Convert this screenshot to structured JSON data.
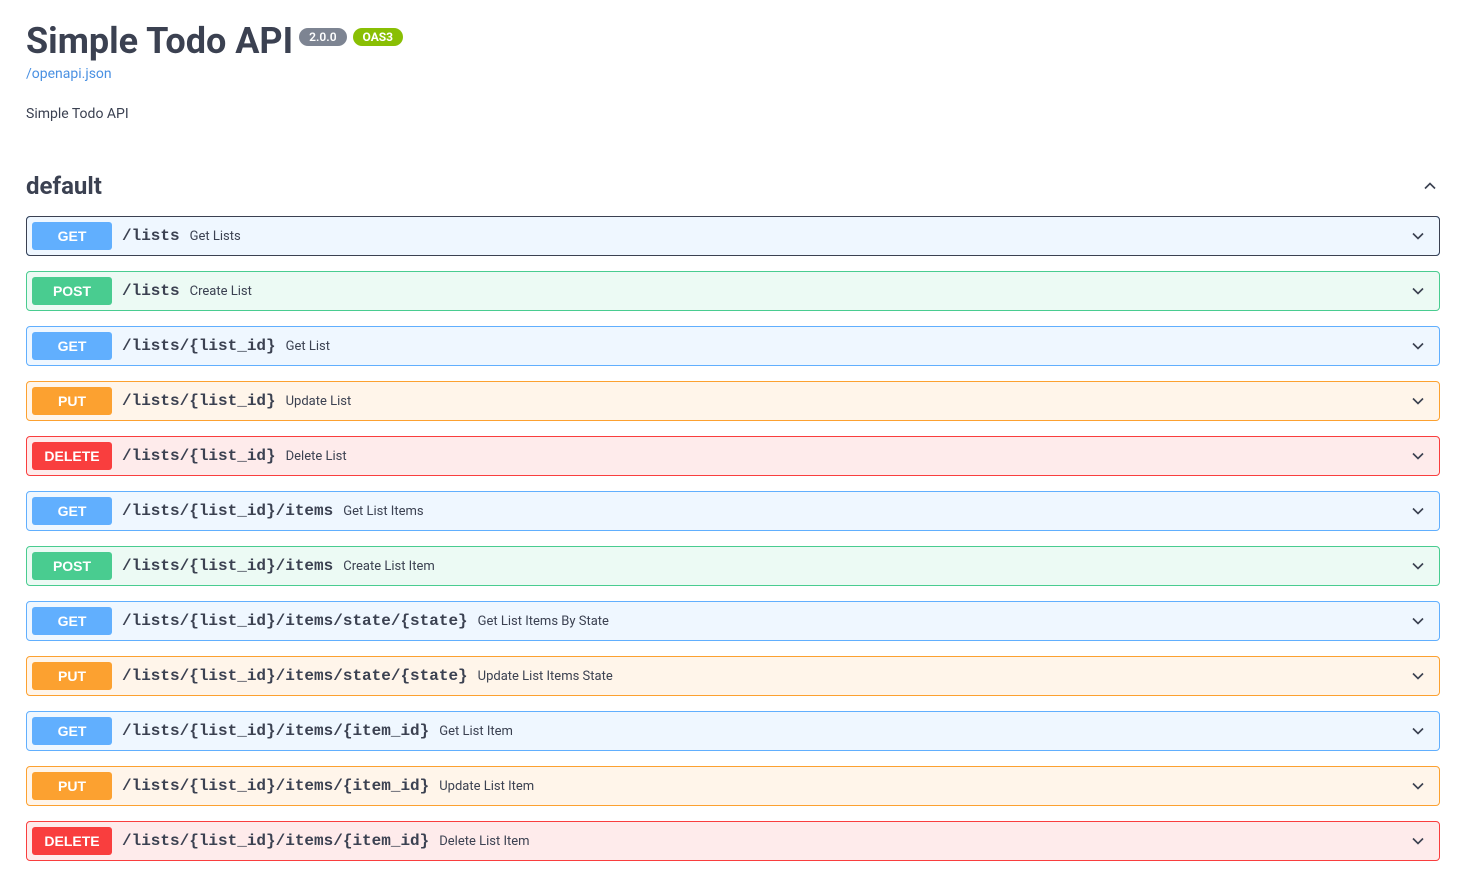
{
  "header": {
    "title": "Simple Todo API",
    "version": "2.0.0",
    "oas_label": "OAS3",
    "spec_link": "/openapi.json",
    "description": "Simple Todo API"
  },
  "section": {
    "title": "default",
    "expanded": true
  },
  "methods": {
    "get": "GET",
    "post": "POST",
    "put": "PUT",
    "delete": "DELETE"
  },
  "operations": [
    {
      "method": "get",
      "path": "/lists",
      "summary": "Get Lists",
      "focused": true
    },
    {
      "method": "post",
      "path": "/lists",
      "summary": "Create List",
      "focused": false
    },
    {
      "method": "get",
      "path": "/lists/{list_id}",
      "summary": "Get List",
      "focused": false
    },
    {
      "method": "put",
      "path": "/lists/{list_id}",
      "summary": "Update List",
      "focused": false
    },
    {
      "method": "delete",
      "path": "/lists/{list_id}",
      "summary": "Delete List",
      "focused": false
    },
    {
      "method": "get",
      "path": "/lists/{list_id}/items",
      "summary": "Get List Items",
      "focused": false
    },
    {
      "method": "post",
      "path": "/lists/{list_id}/items",
      "summary": "Create List Item",
      "focused": false
    },
    {
      "method": "get",
      "path": "/lists/{list_id}/items/state/{state}",
      "summary": "Get List Items By State",
      "focused": false
    },
    {
      "method": "put",
      "path": "/lists/{list_id}/items/state/{state}",
      "summary": "Update List Items State",
      "focused": false
    },
    {
      "method": "get",
      "path": "/lists/{list_id}/items/{item_id}",
      "summary": "Get List Item",
      "focused": false
    },
    {
      "method": "put",
      "path": "/lists/{list_id}/items/{item_id}",
      "summary": "Update List Item",
      "focused": false
    },
    {
      "method": "delete",
      "path": "/lists/{list_id}/items/{item_id}",
      "summary": "Delete List Item",
      "focused": false
    }
  ]
}
